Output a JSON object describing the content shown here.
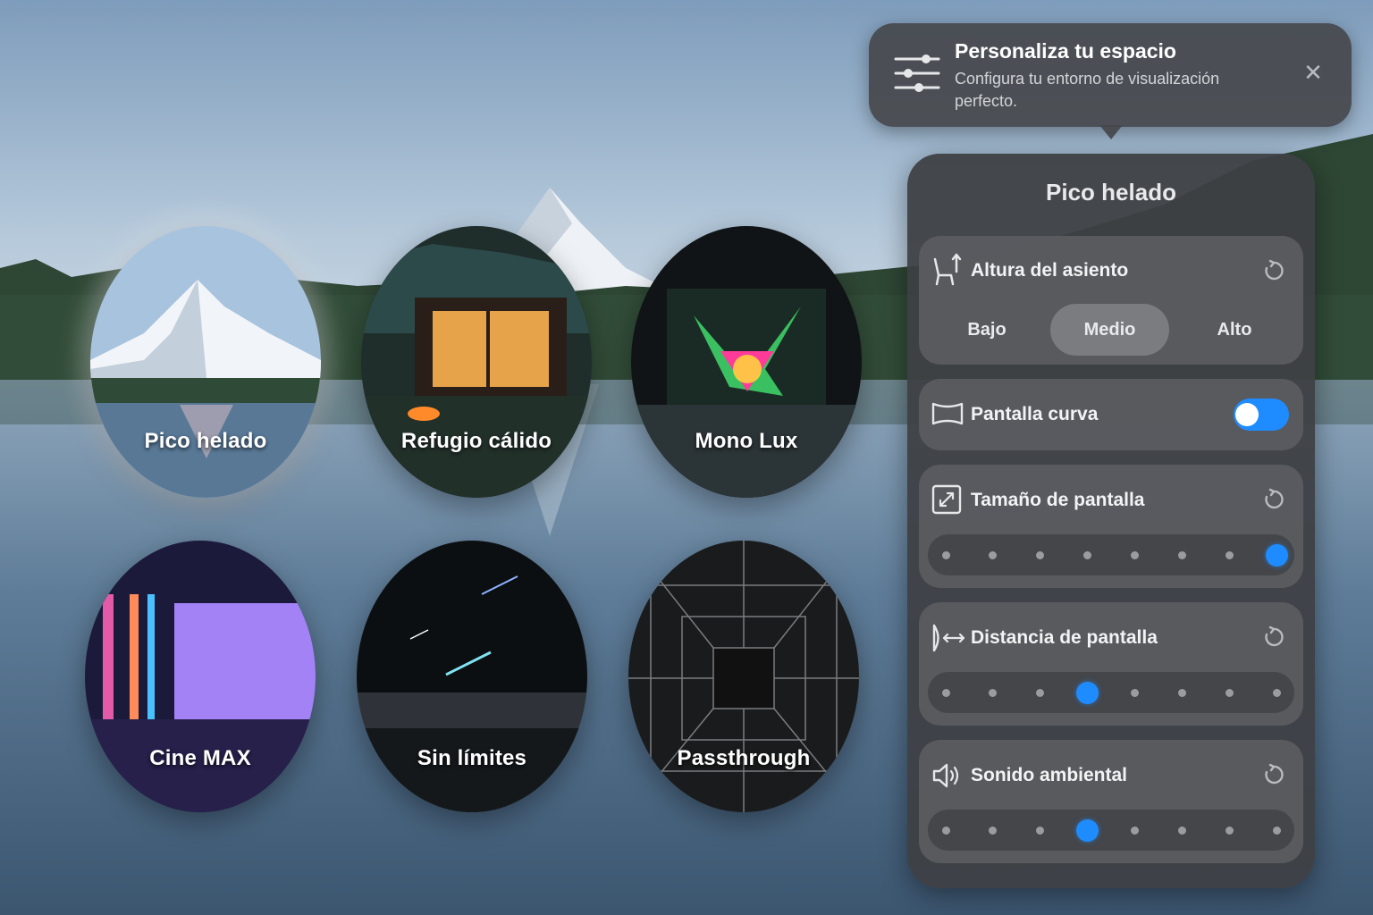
{
  "tooltip": {
    "title": "Personaliza tu espacio",
    "description": "Configura tu entorno de visualización perfecto.",
    "icon": "sliders-icon",
    "close_icon": "close-icon"
  },
  "environments": [
    {
      "label": "Pico helado",
      "selected": true
    },
    {
      "label": "Refugio cálido",
      "selected": false
    },
    {
      "label": "Mono Lux",
      "selected": false
    },
    {
      "label": "Cine MAX",
      "selected": false
    },
    {
      "label": "Sin límites",
      "selected": false
    },
    {
      "label": "Passthrough",
      "selected": false
    }
  ],
  "panel": {
    "title": "Pico helado",
    "seat_height": {
      "label": "Altura del asiento",
      "icon": "seat-icon",
      "options": [
        "Bajo",
        "Medio",
        "Alto"
      ],
      "selected": "Medio"
    },
    "curved_screen": {
      "label": "Pantalla curva",
      "icon": "curved-screen-icon",
      "enabled": true
    },
    "screen_size": {
      "label": "Tamaño de pantalla",
      "icon": "resize-icon",
      "steps": 8,
      "value": 8
    },
    "screen_distance": {
      "label": "Distancia de pantalla",
      "icon": "distance-icon",
      "steps": 8,
      "value": 4
    },
    "ambient_sound": {
      "label": "Sonido ambiental",
      "icon": "speaker-icon",
      "steps": 8,
      "value": 4
    }
  },
  "colors": {
    "accent": "#1e8cff",
    "panel": "#3e4044",
    "card": "#5a5c60"
  }
}
